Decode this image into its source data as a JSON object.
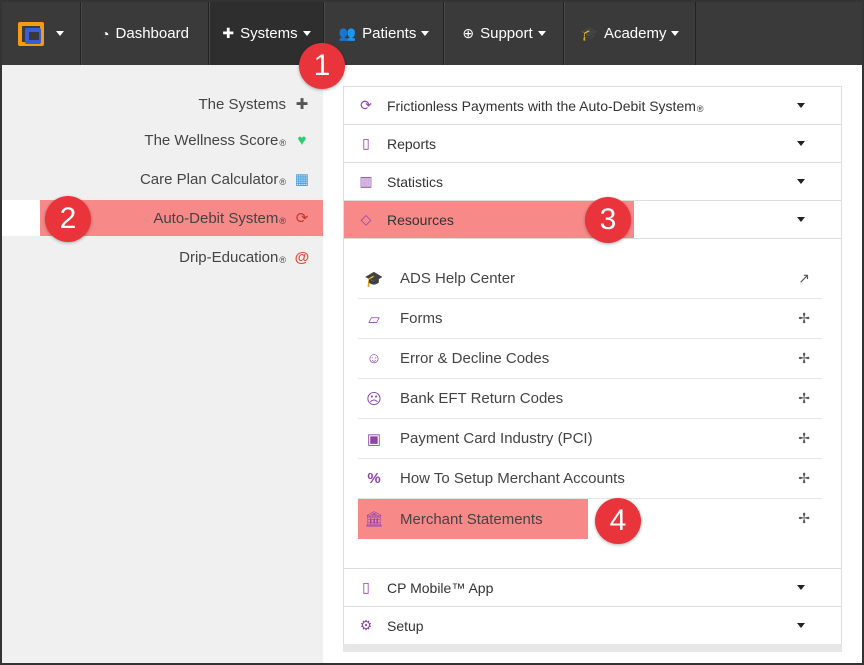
{
  "navbar": {
    "items": [
      {
        "label": "Dashboard",
        "icon": "gauge-icon"
      },
      {
        "label": "Systems",
        "icon": "puzzle-icon"
      },
      {
        "label": "Patients",
        "icon": "users-icon"
      },
      {
        "label": "Support",
        "icon": "lifebuoy-icon"
      },
      {
        "label": "Academy",
        "icon": "graduation-cap-icon"
      }
    ]
  },
  "sidebar": {
    "items": [
      {
        "label": "The Systems",
        "reg": "",
        "icon": "puzzle-icon"
      },
      {
        "label": "The Wellness Score",
        "reg": "®",
        "icon": "heartbeat-icon"
      },
      {
        "label": "Care Plan Calculator",
        "reg": "®",
        "icon": "calculator-icon"
      },
      {
        "label": "Auto-Debit System",
        "reg": "®",
        "icon": "refresh-icon"
      },
      {
        "label": "Drip-Education",
        "reg": "®",
        "icon": "at-icon"
      }
    ]
  },
  "accordion": {
    "items": [
      {
        "label": "Frictionless Payments with the Auto-Debit System",
        "reg": "®",
        "icon": "refresh-icon"
      },
      {
        "label": "Reports",
        "icon": "file-icon"
      },
      {
        "label": "Statistics",
        "icon": "bar-chart-icon"
      },
      {
        "label": "Resources",
        "icon": "diamond-icon"
      },
      {
        "label": "CP Mobile™ App",
        "icon": "mobile-icon"
      },
      {
        "label": "Setup",
        "icon": "cogs-icon"
      }
    ],
    "resources": [
      {
        "label": "ADS Help Center",
        "icon": "graduation-cap-icon",
        "end_icon": "external-link-icon"
      },
      {
        "label": "Forms",
        "icon": "folder-open-icon",
        "end_icon": "pinwheel-icon"
      },
      {
        "label": "Error & Decline Codes",
        "icon": "smile-icon",
        "end_icon": "pinwheel-icon"
      },
      {
        "label": "Bank EFT Return Codes",
        "icon": "frown-icon",
        "end_icon": "pinwheel-icon"
      },
      {
        "label": "Payment Card Industry (PCI)",
        "icon": "lock-icon",
        "end_icon": "pinwheel-icon"
      },
      {
        "label": "How To Setup Merchant Accounts",
        "icon": "percent-icon",
        "end_icon": "pinwheel-icon"
      },
      {
        "label": "Merchant Statements",
        "icon": "bank-icon",
        "end_icon": "pinwheel-icon"
      }
    ]
  },
  "badges": [
    "1",
    "2",
    "3",
    "4"
  ],
  "colors": {
    "navbar": "#3a3a3a",
    "highlight": "#f78989",
    "badge": "#e8343a",
    "accent": "#8e44ad",
    "heart": "#2ecc71",
    "calculator": "#3498db",
    "refresh": "#e74c3c"
  }
}
